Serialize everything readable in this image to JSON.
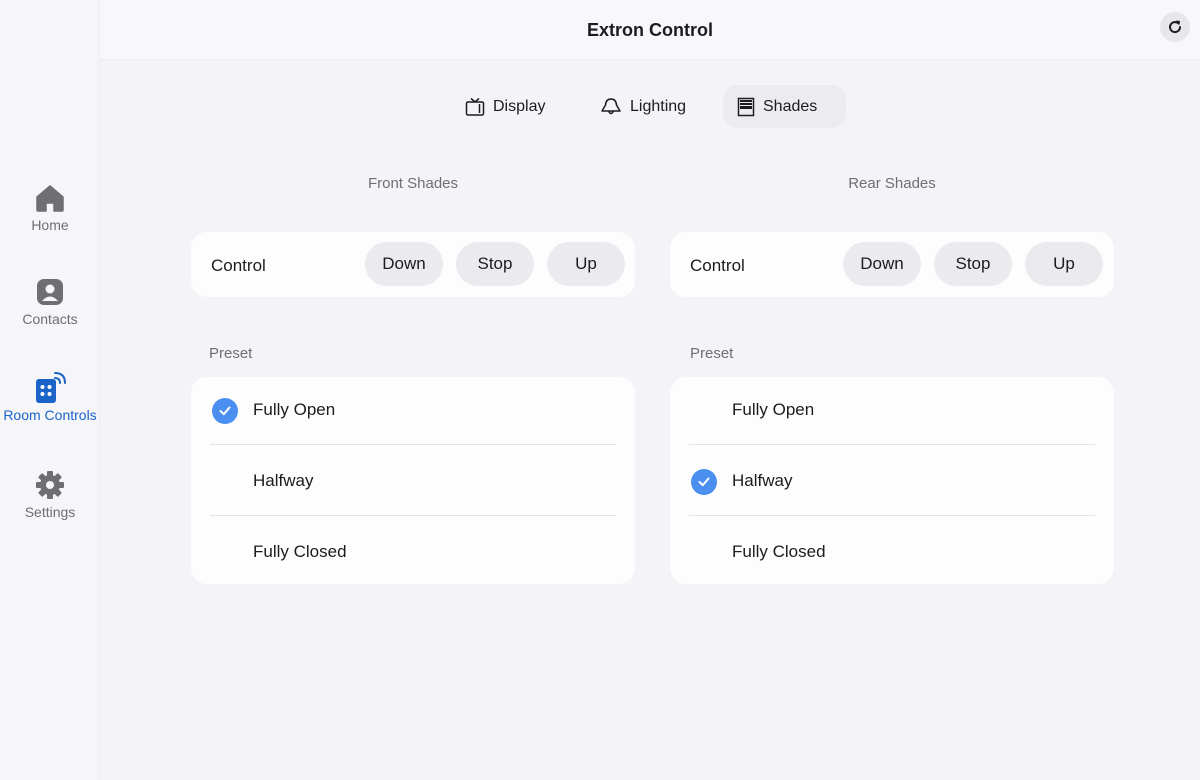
{
  "header": {
    "title": "Extron Control",
    "refresh_icon": "refresh-icon"
  },
  "sidebar": {
    "items": [
      {
        "label": "Home",
        "icon": "home-icon",
        "active": false
      },
      {
        "label": "Contacts",
        "icon": "contact-icon",
        "active": false
      },
      {
        "label": "Room Controls",
        "icon": "room-controls-icon",
        "active": true
      },
      {
        "label": "Settings",
        "icon": "gear-icon",
        "active": false
      }
    ]
  },
  "tabs": [
    {
      "label": "Display",
      "icon": "tv-icon",
      "active": false
    },
    {
      "label": "Lighting",
      "icon": "lamp-icon",
      "active": false
    },
    {
      "label": "Shades",
      "icon": "shades-icon",
      "active": true
    }
  ],
  "colors": {
    "accent": "#1a64c8",
    "check": "#4b8ff0"
  },
  "front": {
    "title": "Front Shades",
    "control_label": "Control",
    "buttons": [
      "Down",
      "Stop",
      "Up"
    ],
    "preset_label": "Preset",
    "presets": [
      {
        "label": "Fully Open",
        "selected": true
      },
      {
        "label": "Halfway",
        "selected": false
      },
      {
        "label": "Fully Closed",
        "selected": false
      }
    ]
  },
  "rear": {
    "title": "Rear Shades",
    "control_label": "Control",
    "buttons": [
      "Down",
      "Stop",
      "Up"
    ],
    "preset_label": "Preset",
    "presets": [
      {
        "label": "Fully Open",
        "selected": false
      },
      {
        "label": "Halfway",
        "selected": true
      },
      {
        "label": "Fully Closed",
        "selected": false
      }
    ]
  }
}
